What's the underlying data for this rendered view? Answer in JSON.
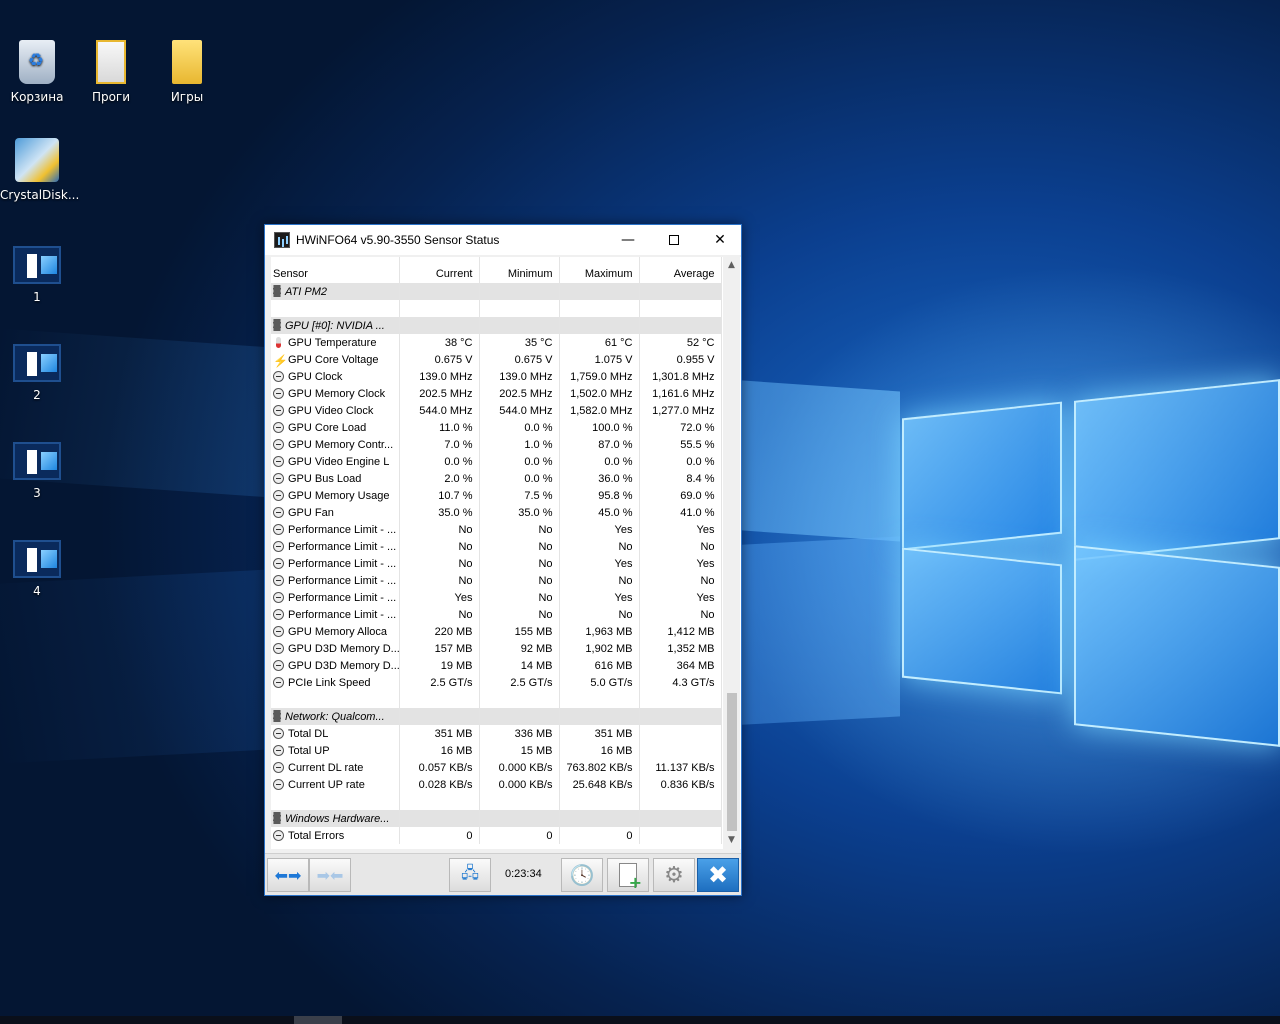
{
  "desktop": {
    "icons": [
      {
        "label": "Корзина",
        "icon": "recycle-bin-icon"
      },
      {
        "label": "Проги",
        "icon": "folder-icon"
      },
      {
        "label": "Игры",
        "icon": "folder-icon"
      },
      {
        "label": "CrystalDisk...",
        "icon": "crystaldisk-icon"
      },
      {
        "label": "1",
        "icon": "virtual-desktop-icon"
      },
      {
        "label": "2",
        "icon": "virtual-desktop-icon"
      },
      {
        "label": "3",
        "icon": "virtual-desktop-icon"
      },
      {
        "label": "4",
        "icon": "virtual-desktop-icon"
      }
    ]
  },
  "window": {
    "title": "HWiNFO64 v5.90-3550 Sensor Status",
    "controls": {
      "minimize": "—",
      "close": "✕"
    },
    "columns": [
      "Sensor",
      "Current",
      "Minimum",
      "Maximum",
      "Average"
    ],
    "rows": [
      {
        "kind": "group",
        "icon": "chip",
        "cells": [
          "ATI PM2",
          "",
          "",
          "",
          ""
        ]
      },
      {
        "kind": "blank",
        "cells": [
          "",
          "",
          "",
          "",
          ""
        ]
      },
      {
        "kind": "group",
        "icon": "chip",
        "cells": [
          "GPU [#0]: NVIDIA ...",
          "",
          "",
          "",
          ""
        ]
      },
      {
        "kind": "row",
        "icon": "therm",
        "cells": [
          "GPU Temperature",
          "38 °C",
          "35 °C",
          "61 °C",
          "52 °C"
        ]
      },
      {
        "kind": "row",
        "icon": "bolt",
        "cells": [
          "GPU Core Voltage",
          "0.675 V",
          "0.675 V",
          "1.075 V",
          "0.955 V"
        ]
      },
      {
        "kind": "row",
        "icon": "gauge",
        "cells": [
          "GPU Clock",
          "139.0 MHz",
          "139.0 MHz",
          "1,759.0 MHz",
          "1,301.8 MHz"
        ]
      },
      {
        "kind": "row",
        "icon": "gauge",
        "cells": [
          "GPU Memory Clock",
          "202.5 MHz",
          "202.5 MHz",
          "1,502.0 MHz",
          "1,161.6 MHz"
        ]
      },
      {
        "kind": "row",
        "icon": "gauge",
        "cells": [
          "GPU Video Clock",
          "544.0 MHz",
          "544.0 MHz",
          "1,582.0 MHz",
          "1,277.0 MHz"
        ]
      },
      {
        "kind": "row",
        "icon": "gauge",
        "cells": [
          "GPU Core Load",
          "11.0 %",
          "0.0 %",
          "100.0 %",
          "72.0 %"
        ]
      },
      {
        "kind": "row",
        "icon": "gauge",
        "cells": [
          "GPU Memory Contr...",
          "7.0 %",
          "1.0 %",
          "87.0 %",
          "55.5 %"
        ]
      },
      {
        "kind": "row",
        "icon": "gauge",
        "cells": [
          "GPU Video Engine L",
          "0.0 %",
          "0.0 %",
          "0.0 %",
          "0.0 %"
        ]
      },
      {
        "kind": "row",
        "icon": "gauge",
        "cells": [
          "GPU Bus Load",
          "2.0 %",
          "0.0 %",
          "36.0 %",
          "8.4 %"
        ]
      },
      {
        "kind": "row",
        "icon": "gauge",
        "cells": [
          "GPU Memory Usage",
          "10.7 %",
          "7.5 %",
          "95.8 %",
          "69.0 %"
        ]
      },
      {
        "kind": "row",
        "icon": "gauge",
        "cells": [
          "GPU Fan",
          "35.0 %",
          "35.0 %",
          "45.0 %",
          "41.0 %"
        ]
      },
      {
        "kind": "row",
        "icon": "gauge",
        "cells": [
          "Performance Limit - ...",
          "No",
          "No",
          "Yes",
          "Yes"
        ]
      },
      {
        "kind": "row",
        "icon": "gauge",
        "cells": [
          "Performance Limit - ...",
          "No",
          "No",
          "No",
          "No"
        ]
      },
      {
        "kind": "row",
        "icon": "gauge",
        "cells": [
          "Performance Limit - ...",
          "No",
          "No",
          "Yes",
          "Yes"
        ]
      },
      {
        "kind": "row",
        "icon": "gauge",
        "cells": [
          "Performance Limit - ...",
          "No",
          "No",
          "No",
          "No"
        ]
      },
      {
        "kind": "row",
        "icon": "gauge",
        "cells": [
          "Performance Limit - ...",
          "Yes",
          "No",
          "Yes",
          "Yes"
        ]
      },
      {
        "kind": "row",
        "icon": "gauge",
        "cells": [
          "Performance Limit - ...",
          "No",
          "No",
          "No",
          "No"
        ]
      },
      {
        "kind": "row",
        "icon": "gauge",
        "cells": [
          "GPU Memory Alloca",
          "220 MB",
          "155 MB",
          "1,963 MB",
          "1,412 MB"
        ]
      },
      {
        "kind": "row",
        "icon": "gauge",
        "cells": [
          "GPU D3D Memory D...",
          "157 MB",
          "92 MB",
          "1,902 MB",
          "1,352 MB"
        ]
      },
      {
        "kind": "row",
        "icon": "gauge",
        "cells": [
          "GPU D3D Memory D...",
          "19 MB",
          "14 MB",
          "616 MB",
          "364 MB"
        ]
      },
      {
        "kind": "row",
        "icon": "gauge",
        "cells": [
          "PCIe Link Speed",
          "2.5 GT/s",
          "2.5 GT/s",
          "5.0 GT/s",
          "4.3 GT/s"
        ]
      },
      {
        "kind": "blank",
        "cells": [
          "",
          "",
          "",
          "",
          ""
        ]
      },
      {
        "kind": "group",
        "icon": "chip",
        "cells": [
          "Network: Qualcom...",
          "",
          "",
          "",
          ""
        ]
      },
      {
        "kind": "row",
        "icon": "gauge",
        "cells": [
          "Total DL",
          "351 MB",
          "336 MB",
          "351 MB",
          ""
        ]
      },
      {
        "kind": "row",
        "icon": "gauge",
        "cells": [
          "Total UP",
          "16 MB",
          "15 MB",
          "16 MB",
          ""
        ]
      },
      {
        "kind": "row",
        "icon": "gauge",
        "cells": [
          "Current DL rate",
          "0.057 KB/s",
          "0.000 KB/s",
          "763.802 KB/s",
          "11.137 KB/s"
        ]
      },
      {
        "kind": "row",
        "icon": "gauge",
        "cells": [
          "Current UP rate",
          "0.028 KB/s",
          "0.000 KB/s",
          "25.648 KB/s",
          "0.836 KB/s"
        ]
      },
      {
        "kind": "blank",
        "cells": [
          "",
          "",
          "",
          "",
          ""
        ]
      },
      {
        "kind": "group",
        "icon": "chip",
        "cells": [
          "Windows Hardware...",
          "",
          "",
          "",
          ""
        ]
      },
      {
        "kind": "row",
        "icon": "gauge",
        "cells": [
          "Total Errors",
          "0",
          "0",
          "0",
          ""
        ]
      }
    ],
    "toolbar": {
      "timer": "0:23:34",
      "icons": [
        "expand-arrows-icon",
        "collapse-arrows-icon",
        "network-icon",
        "clock-icon",
        "log-add-icon",
        "settings-gear-icon",
        "close-x-icon"
      ]
    }
  }
}
